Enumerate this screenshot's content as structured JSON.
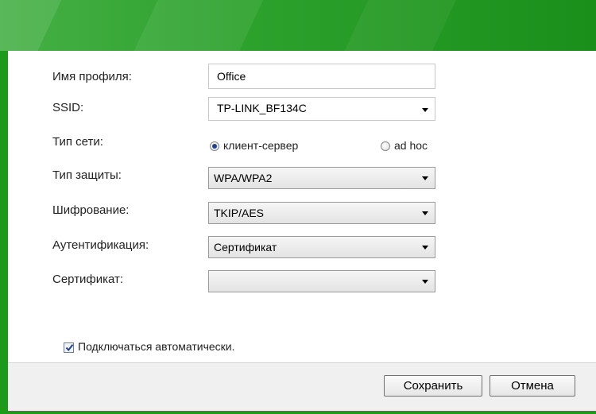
{
  "form": {
    "profile_name_label": "Имя профиля:",
    "profile_name_value": "Office",
    "ssid_label": "SSID:",
    "ssid_value": "TP-LINK_BF134C",
    "network_type_label": "Тип сети:",
    "network_type_options": {
      "client_server": "клиент-сервер",
      "ad_hoc": "ad hoc"
    },
    "network_type_selected": "клиент-сервер",
    "security_type_label": "Тип защиты:",
    "security_type_value": "WPA/WPA2",
    "encryption_label": "Шифрование:",
    "encryption_value": "TKIP/AES",
    "authentication_label": "Аутентификация:",
    "authentication_value": "Сертификат",
    "certificate_label": "Сертификат:",
    "certificate_value": "",
    "auto_connect_label": "Подключаться автоматически.",
    "auto_connect_checked": true
  },
  "footer": {
    "save_label": "Сохранить",
    "cancel_label": "Отмена"
  },
  "colors": {
    "frame_green": "#1c9a1c",
    "header_green": "#2da22d"
  }
}
